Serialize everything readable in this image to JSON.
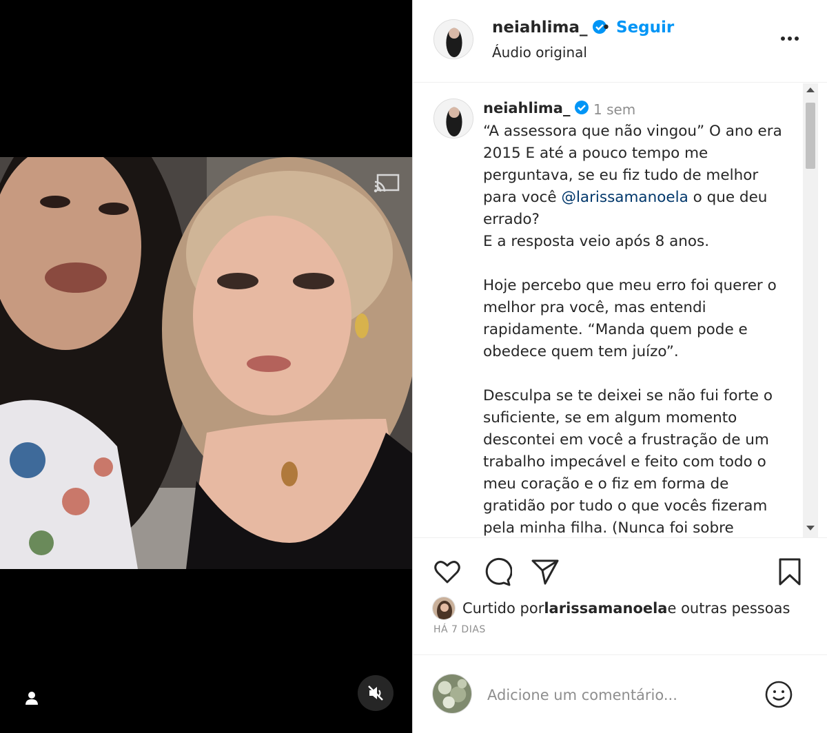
{
  "post": {
    "username": "neiahlima_",
    "follow_label": "Seguir",
    "separator": "•",
    "audio": "Áudio original",
    "verified_color": "#0095f6"
  },
  "caption": {
    "username": "neiahlima_",
    "time": "1 sem",
    "text_part1": "“A assessora que não vingou” O ano era 2015 E até a pouco tempo me perguntava, se eu fiz tudo de melhor para você ",
    "mention": "@larissamanoela",
    "text_part2": " o que deu errado?\nE a resposta veio após 8 anos.\n\nHoje percebo que meu erro foi querer o melhor pra você, mas entendi rapidamente. “Manda quem pode e obedece quem tem juízo”.\n\nDesculpa se te deixei se não fui forte o suficiente, se em algum momento descontei em você a frustração de um trabalho impecável e feito com todo o meu coração e o fiz em forma de gratidão por tudo o que vocês fizeram pela minha filha. (Nunca foi sobre"
  },
  "likes": {
    "prefix": "Curtido por ",
    "user": "larissamanoela",
    "suffix": " e outras pessoas"
  },
  "time_ago": "HÁ 7 DIAS",
  "comment_box": {
    "placeholder": "Adicione um comentário..."
  },
  "icons": {
    "like": "heart-icon",
    "comment": "comment-icon",
    "share": "send-icon",
    "save": "bookmark-icon",
    "more": "more-icon",
    "cast": "cast-icon",
    "mute": "muted-speaker-icon",
    "tags": "user-tag-icon",
    "emoji": "emoji-icon"
  }
}
